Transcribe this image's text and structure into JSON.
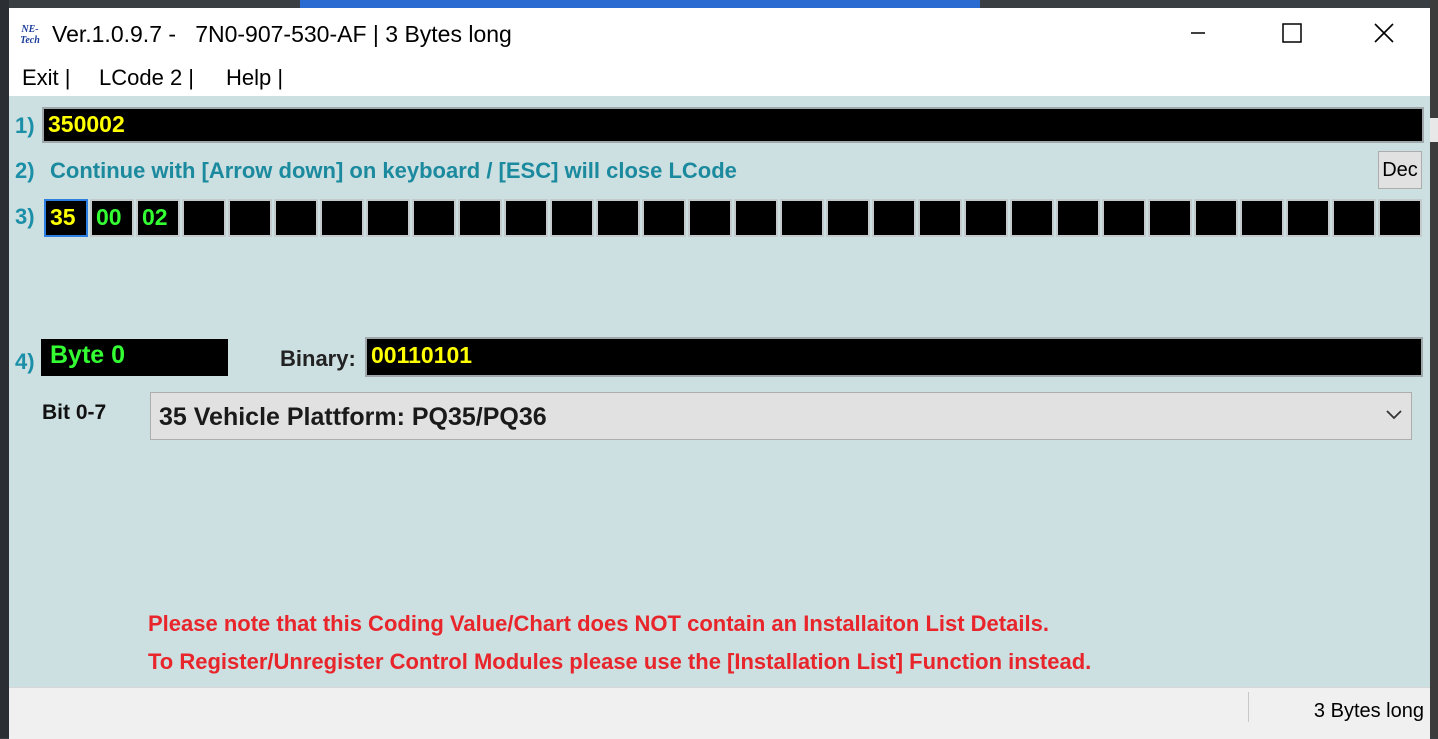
{
  "window": {
    "title": "Ver.1.0.9.7 -   7N0-907-530-AF | 3 Bytes long",
    "logo_text": "NE-Tech"
  },
  "menu": [
    "Exit |",
    "LCode 2 |",
    "Help |"
  ],
  "rows": {
    "n1": "1)",
    "n2": "2)",
    "n3": "3)",
    "n4": "4)"
  },
  "coding_value": "350002",
  "hint": "Continue with [Arrow down] on keyboard / [ESC] will close LCode",
  "dec_button": "Dec",
  "bytes": [
    {
      "value": "35",
      "color": "#ffff00",
      "selected": true
    },
    {
      "value": "00",
      "color": "#33ff33"
    },
    {
      "value": "02",
      "color": "#33ff33"
    },
    {
      "value": ""
    },
    {
      "value": ""
    },
    {
      "value": ""
    },
    {
      "value": ""
    },
    {
      "value": ""
    },
    {
      "value": ""
    },
    {
      "value": ""
    },
    {
      "value": ""
    },
    {
      "value": ""
    },
    {
      "value": ""
    },
    {
      "value": ""
    },
    {
      "value": ""
    },
    {
      "value": ""
    },
    {
      "value": ""
    },
    {
      "value": ""
    },
    {
      "value": ""
    },
    {
      "value": ""
    },
    {
      "value": ""
    },
    {
      "value": ""
    },
    {
      "value": ""
    },
    {
      "value": ""
    },
    {
      "value": ""
    },
    {
      "value": ""
    },
    {
      "value": ""
    },
    {
      "value": ""
    },
    {
      "value": ""
    },
    {
      "value": ""
    }
  ],
  "byte_label": "Byte 0",
  "binary_label": "Binary:",
  "binary_value": "00110101",
  "bit_label": "Bit 0-7",
  "select_value": "35 Vehicle Plattform: PQ35/PQ36",
  "notes": [
    "Please note that this Coding Value/Chart does NOT contain an Installaiton List Details.",
    "To Register/Unregister Control Modules please use the [Installation List] Function instead."
  ],
  "status": "3 Bytes long",
  "colors": {
    "panel_bg": "#ccdfe1",
    "hex_yellow": "#ffff00",
    "hex_green": "#33ff33",
    "note_red": "#e8252b",
    "label_teal": "#1c8fa8"
  }
}
